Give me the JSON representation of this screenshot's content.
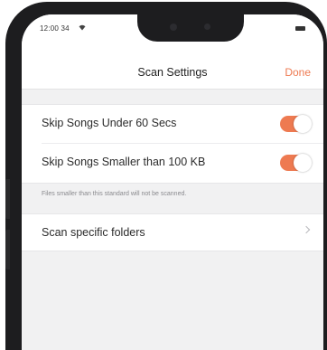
{
  "status_bar": {
    "time": "12:00 34",
    "wifi_icon": "wifi-icon",
    "battery_icon": "battery-icon"
  },
  "header": {
    "title": "Scan Settings",
    "done_label": "Done"
  },
  "settings": {
    "toggles": [
      {
        "label": "Skip Songs Under 60 Secs",
        "enabled": true
      },
      {
        "label": "Skip Songs Smaller than 100 KB",
        "enabled": true
      }
    ],
    "footnote": "Files smaller than this standard will not be scanned.",
    "folders_label": "Scan specific folders",
    "chevron_icon": "chevron-right-icon"
  },
  "colors": {
    "accent": "#ee7a51",
    "background": "#f1f1f2",
    "phone_frame": "#1d1d1f"
  }
}
